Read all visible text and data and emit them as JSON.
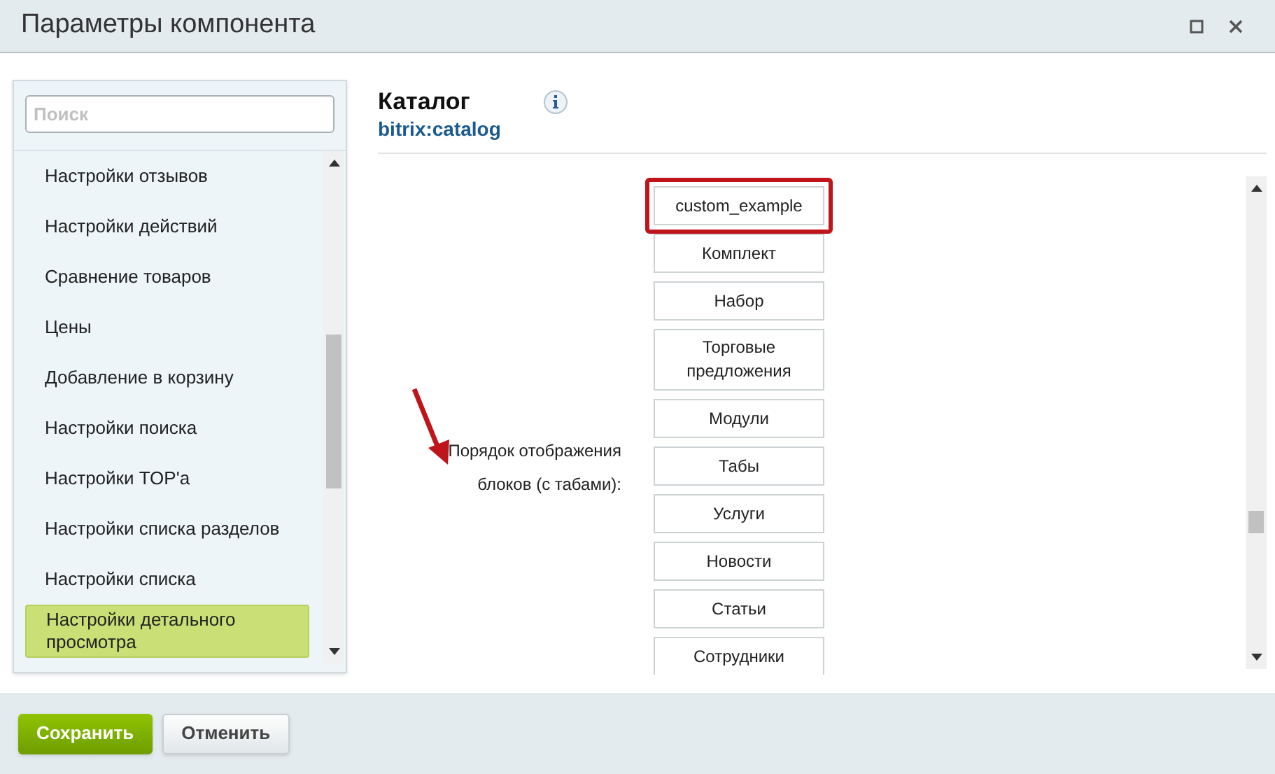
{
  "window": {
    "title": "Параметры компонента"
  },
  "sidebar": {
    "search": {
      "placeholder": "Поиск"
    },
    "items": [
      {
        "label": "Настройки отзывов",
        "selected": false
      },
      {
        "label": "Настройки действий",
        "selected": false
      },
      {
        "label": "Сравнение товаров",
        "selected": false
      },
      {
        "label": "Цены",
        "selected": false
      },
      {
        "label": "Добавление в корзину",
        "selected": false
      },
      {
        "label": "Настройки поиска",
        "selected": false
      },
      {
        "label": "Настройки TOP'а",
        "selected": false
      },
      {
        "label": "Настройки списка разделов",
        "selected": false
      },
      {
        "label": "Настройки списка",
        "selected": false
      },
      {
        "label": "Настройки детального просмотра",
        "selected": true
      }
    ]
  },
  "component": {
    "title": "Каталог",
    "code": "bitrix:catalog"
  },
  "setting": {
    "label": "Порядок отображения блоков (с табами):",
    "blocks": [
      {
        "label": "custom_example",
        "highlighted": true
      },
      {
        "label": "Комплект",
        "highlighted": false
      },
      {
        "label": "Набор",
        "highlighted": false
      },
      {
        "label": "Торговые предложения",
        "highlighted": false
      },
      {
        "label": "Модули",
        "highlighted": false
      },
      {
        "label": "Табы",
        "highlighted": false
      },
      {
        "label": "Услуги",
        "highlighted": false
      },
      {
        "label": "Новости",
        "highlighted": false
      },
      {
        "label": "Статьи",
        "highlighted": false
      },
      {
        "label": "Сотрудники",
        "highlighted": false
      }
    ]
  },
  "buttons": [
    {
      "label": "Сохранить",
      "kind": "primary"
    },
    {
      "label": "Отменить",
      "kind": "secondary"
    }
  ]
}
